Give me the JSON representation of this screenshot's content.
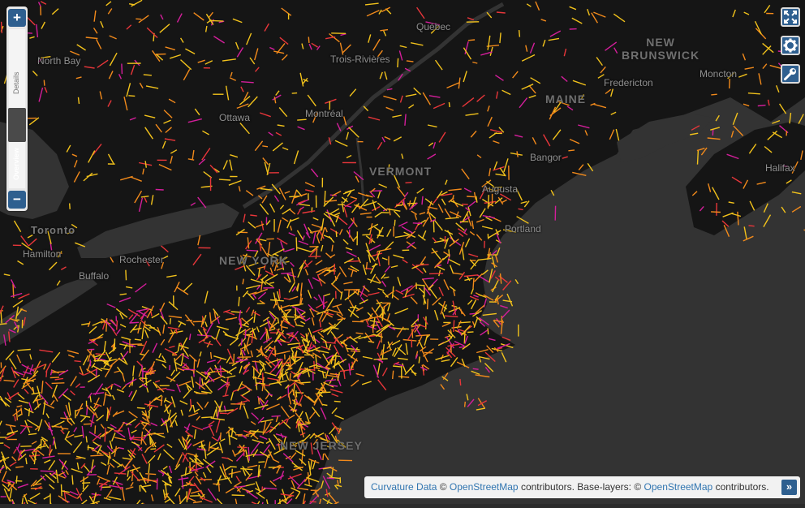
{
  "map": {
    "places": [
      {
        "name": "Québec"
      },
      {
        "name": "North Bay"
      },
      {
        "name": "Trois-Rivières"
      },
      {
        "name": "Ottawa"
      },
      {
        "name": "Montréal"
      },
      {
        "name": "Fredericton"
      },
      {
        "name": "Moncton"
      },
      {
        "name": "Bangor"
      },
      {
        "name": "Augusta"
      },
      {
        "name": "Portland"
      },
      {
        "name": "Toronto"
      },
      {
        "name": "Hamilton"
      },
      {
        "name": "Rochester"
      },
      {
        "name": "Buffalo"
      },
      {
        "name": "Halifax"
      }
    ],
    "regions": [
      {
        "name": "NEW\nBRUNSWICK"
      },
      {
        "name": "MAINE"
      },
      {
        "name": "VERMONT"
      },
      {
        "name": "NEW YORK"
      },
      {
        "name": "NEW JERSEY"
      }
    ],
    "colors": {
      "background": "#2b2b2b",
      "land": "#141414",
      "water": "#333333",
      "road_low": "#f2c21b",
      "road_mid": "#f28a1b",
      "road_high": "#e8363a",
      "road_max": "#d41e9b",
      "accent": "#2e5f8f"
    }
  },
  "zoom_control": {
    "zoom_in_label": "+",
    "zoom_out_label": "−",
    "details_label": "Details",
    "overview_label": "Overview"
  },
  "toolbar": {
    "fullscreen_icon": "fullscreen-icon",
    "settings_icon": "gear-icon",
    "key_icon": "wrench-icon"
  },
  "attribution": {
    "link1": "Curvature Data",
    "text1": " © ",
    "link2": "OpenStreetMap",
    "text2": " contributors. Base-layers: © ",
    "link3": "OpenStreetMap",
    "text3": " contributors.",
    "toggle_label": "»"
  }
}
